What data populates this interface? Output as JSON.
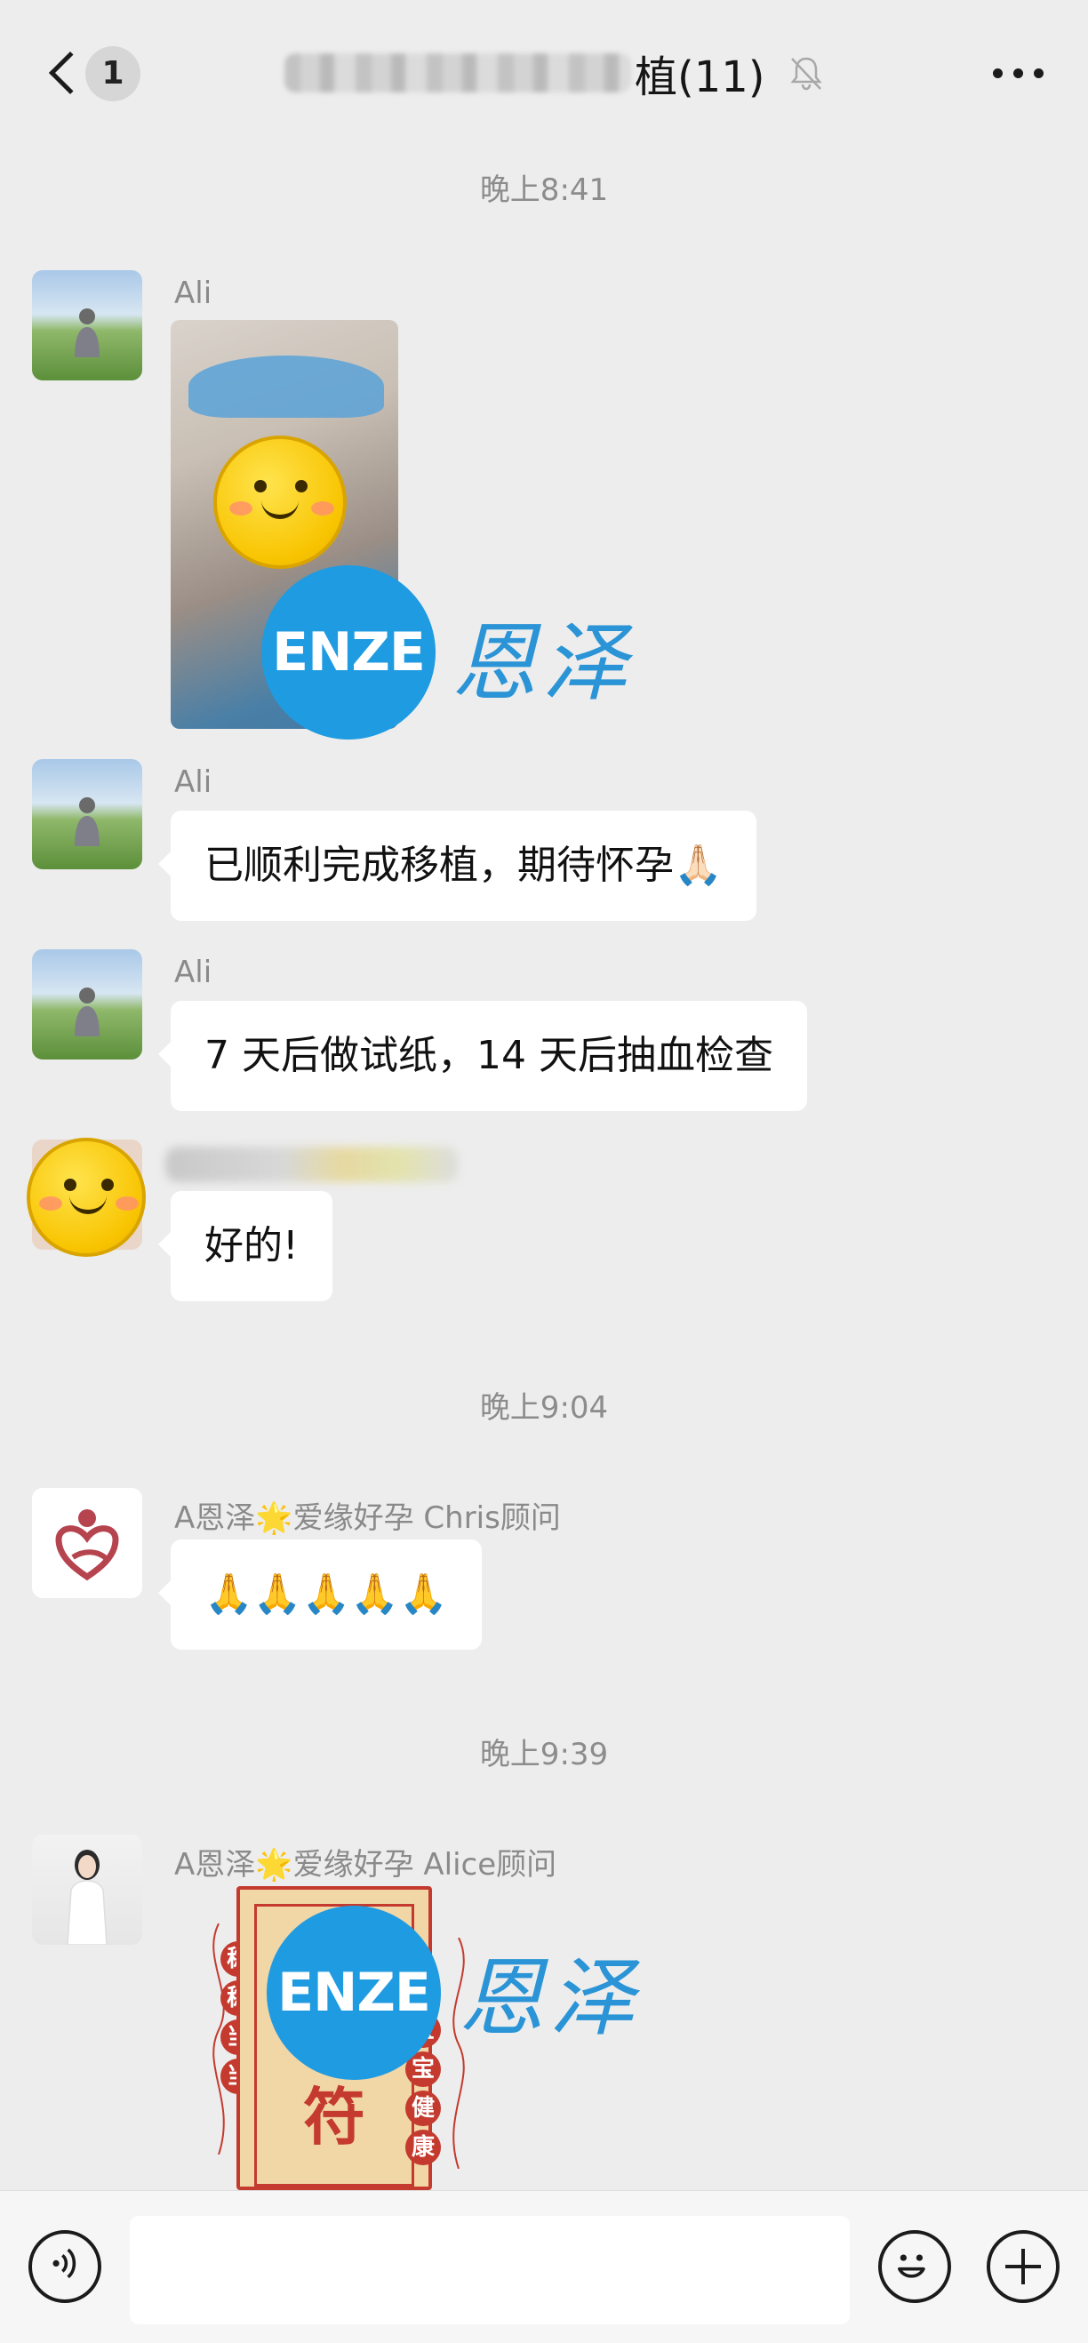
{
  "header": {
    "back_badge": "1",
    "title_suffix": "植(11)",
    "muted": true
  },
  "timestamps": [
    "晚上8:41",
    "晚上9:04",
    "晚上9:39"
  ],
  "messages": [
    {
      "sender": "Ali",
      "type": "image",
      "watermark_en": "ENZE",
      "watermark_cn": "恩泽"
    },
    {
      "sender": "Ali",
      "type": "text",
      "text": "已顺利完成移植，期待怀孕🙏🏻"
    },
    {
      "sender": "Ali",
      "type": "text",
      "text": "7 天后做试纸，14 天后抽血检查"
    },
    {
      "sender": "",
      "type": "text",
      "text": "好的!"
    },
    {
      "sender": "A恩泽🌟爱缘好孕 Chris顾问",
      "type": "text",
      "text": "🙏🙏🙏🙏🙏"
    },
    {
      "sender": "A恩泽🌟爱缘好孕 Alice顾问",
      "type": "image",
      "watermark_en": "ENZE",
      "watermark_cn": "恩泽",
      "amulet": {
        "char": "符",
        "left_seals": [
          "稳",
          "稳",
          "当",
          "当"
        ],
        "right_seals": [
          "宝",
          "宝",
          "健",
          "康"
        ]
      }
    }
  ],
  "input": {
    "placeholder": ""
  },
  "colors": {
    "background": "#ededed",
    "bubble": "#ffffff",
    "accent": "#1f9be2",
    "amulet_red": "#c43a2e"
  }
}
